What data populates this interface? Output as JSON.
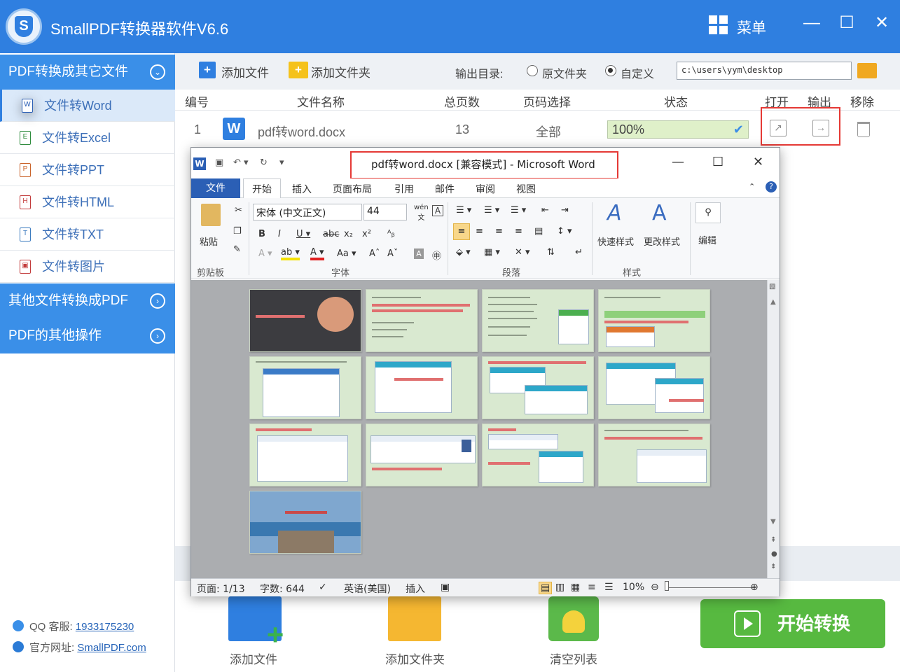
{
  "app": {
    "title": "SmallPDF转换器软件V6.6",
    "menu_label": "菜单"
  },
  "sidebar": {
    "section1": "PDF转换成其它文件",
    "items": [
      {
        "label": "文件转Word",
        "icon": "W"
      },
      {
        "label": "文件转Excel",
        "icon": "E"
      },
      {
        "label": "文件转PPT",
        "icon": "P"
      },
      {
        "label": "文件转HTML",
        "icon": "H"
      },
      {
        "label": "文件转TXT",
        "icon": "T"
      },
      {
        "label": "文件转图片",
        "icon": "▣"
      }
    ],
    "section2": "其他文件转换成PDF",
    "section3": "PDF的其他操作",
    "qq_label": "QQ 客服:",
    "qq_number": "1933175230",
    "site_label": "官方网址:",
    "site_url": "SmallPDF.com"
  },
  "toolbar": {
    "add_file": "添加文件",
    "add_folder": "添加文件夹",
    "output_label": "输出目录:",
    "radio_original": "原文件夹",
    "radio_custom": "自定义",
    "output_path": "c:\\users\\yym\\desktop"
  },
  "table": {
    "headers": [
      "编号",
      "文件名称",
      "总页数",
      "页码选择",
      "状态",
      "打开",
      "输出",
      "移除"
    ],
    "rows": [
      {
        "num": "1",
        "name": "pdf转word.docx",
        "pages": "13",
        "range": "全部",
        "status": "100%",
        "progress": 1.0
      }
    ]
  },
  "bottom": {
    "add_file": "添加文件",
    "add_folder": "添加文件夹",
    "clear": "清空列表",
    "start": "开始转换"
  },
  "word": {
    "title": "pdf转word.docx [兼容模式] - Microsoft Word",
    "tabs": [
      "文件",
      "开始",
      "插入",
      "页面布局",
      "引用",
      "邮件",
      "审阅",
      "视图"
    ],
    "font_name": "宋体 (中文正文)",
    "font_size": "44",
    "groups": {
      "clipboard": "剪贴板",
      "paste": "粘贴",
      "font": "字体",
      "paragraph": "段落",
      "styles": "样式",
      "quick_style": "快速样式",
      "change_style": "更改样式",
      "edit": "编辑"
    },
    "status": {
      "page": "页面: 1/13",
      "words": "字数: 644",
      "lang": "英语(美国)",
      "mode": "插入",
      "zoom": "10%"
    }
  },
  "colors": {
    "brand_blue": "#2f7fe0",
    "start_green": "#57b940",
    "highlight_red": "#e53935",
    "word_blue": "#2b5fb5"
  }
}
